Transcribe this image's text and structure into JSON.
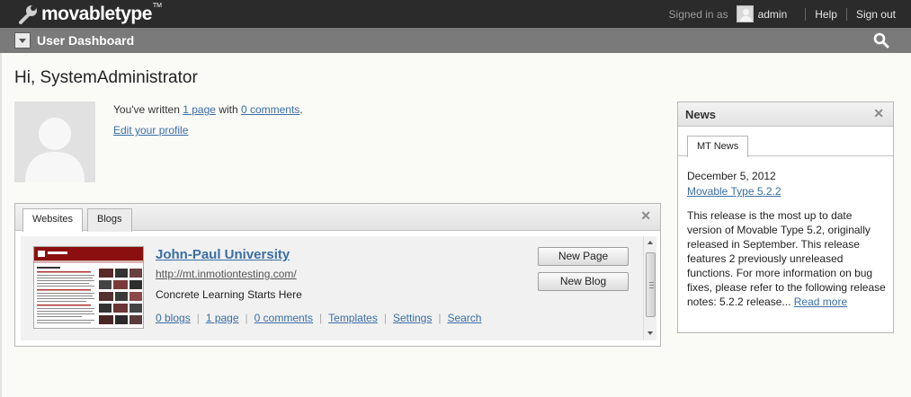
{
  "app": {
    "brand": "movabletype",
    "tm": "TM"
  },
  "topbar": {
    "signed_in_as": "Signed in as",
    "username": "admin",
    "help": "Help",
    "sign_out": "Sign out"
  },
  "dashbar": {
    "title": "User Dashboard"
  },
  "greeting": "Hi, SystemAdministrator",
  "profile": {
    "written_prefix": "You've written ",
    "pages_link": "1 page",
    "with": " with ",
    "comments_link": "0 comments",
    "period": ".",
    "edit_profile": "Edit your profile"
  },
  "sites_widget": {
    "tabs": [
      "Websites",
      "Blogs"
    ],
    "site": {
      "name": "John-Paul University",
      "url": "http://mt.inmotiontesting.com/",
      "description": "Concrete Learning Starts Here",
      "links": [
        "0 blogs",
        "1 page",
        "0 comments",
        "Templates",
        "Settings",
        "Search"
      ],
      "buttons": {
        "new_page": "New Page",
        "new_blog": "New Blog"
      }
    }
  },
  "news_widget": {
    "title": "News",
    "tab": "MT News",
    "date": "December 5, 2012",
    "headline": "Movable Type 5.2.2",
    "body": "This release is the most up to date version of Movable Type 5.2, originally released in September. This release features 2 previously unreleased functions. For more information on bug fixes, please refer to the following release notes: 5.2.2 release... ",
    "read_more": "Read more"
  },
  "colors": {
    "topbar_bg": "#2b2b2b",
    "dashbar_bg": "#7a7a7a",
    "link": "#3a6ea5",
    "page_bg": "#fafaf7"
  }
}
